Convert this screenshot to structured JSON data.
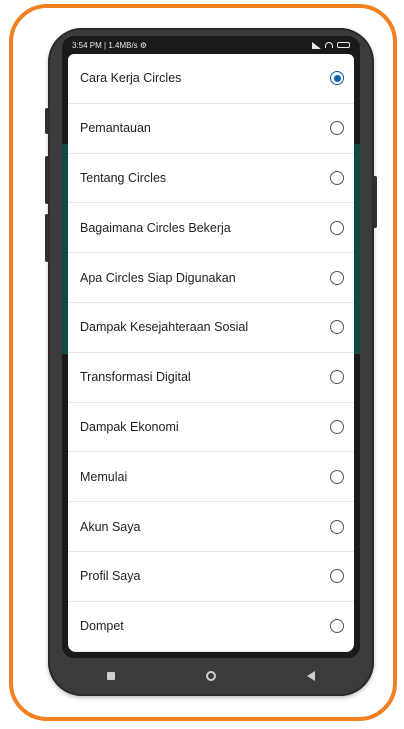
{
  "statusbar": {
    "left_text": "3:54 PM | 1.4MB/s ⚙",
    "signal_icon": "signal-icon",
    "wifi_icon": "wifi-icon",
    "battery_icon": "battery-icon"
  },
  "options": [
    {
      "label": "Cara Kerja Circles",
      "selected": true
    },
    {
      "label": "Pemantauan",
      "selected": false
    },
    {
      "label": "Tentang Circles",
      "selected": false
    },
    {
      "label": "Bagaimana Circles Bekerja",
      "selected": false
    },
    {
      "label": "Apa Circles Siap Digunakan",
      "selected": false
    },
    {
      "label": "Dampak Kesejahteraan Sosial",
      "selected": false
    },
    {
      "label": "Transformasi Digital",
      "selected": false
    },
    {
      "label": "Dampak Ekonomi",
      "selected": false
    },
    {
      "label": "Memulai",
      "selected": false
    },
    {
      "label": "Akun Saya",
      "selected": false
    },
    {
      "label": "Profil Saya",
      "selected": false
    },
    {
      "label": "Dompet",
      "selected": false
    }
  ],
  "navbar": {
    "recents_icon": "square-icon",
    "home_icon": "circle-home-icon",
    "back_icon": "back-triangle-icon"
  },
  "colors": {
    "frame": "#f3801f",
    "accent": "#0b5ea8",
    "side_strip": "#0c4a44"
  }
}
